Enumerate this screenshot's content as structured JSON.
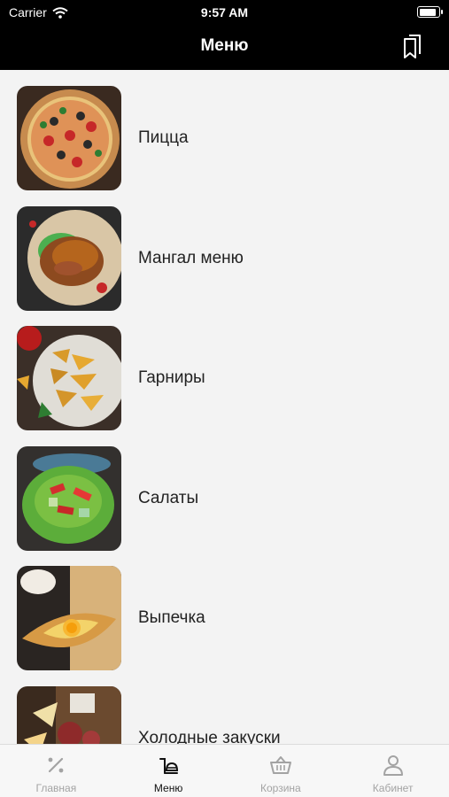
{
  "status_bar": {
    "carrier": "Carrier",
    "time": "9:57 AM",
    "battery_level": 0.9
  },
  "nav": {
    "title": "Меню",
    "right_icon": "bookmarks-icon"
  },
  "menu": {
    "items": [
      {
        "label": "Пицца",
        "image": "pizza-photo"
      },
      {
        "label": "Мангал меню",
        "image": "grilled-meat-photo"
      },
      {
        "label": "Гарниры",
        "image": "potato-wedges-photo"
      },
      {
        "label": "Салаты",
        "image": "salad-photo"
      },
      {
        "label": "Выпечка",
        "image": "khachapuri-photo"
      },
      {
        "label": "Холодные закуски",
        "image": "cold-appetizers-photo"
      }
    ]
  },
  "tabbar": {
    "tabs": [
      {
        "label": "Главная",
        "icon": "percent-icon",
        "active": false
      },
      {
        "label": "Меню",
        "icon": "menu-tray-icon",
        "active": true
      },
      {
        "label": "Корзина",
        "icon": "basket-icon",
        "active": false
      },
      {
        "label": "Кабинет",
        "icon": "user-icon",
        "active": false
      }
    ]
  },
  "colors": {
    "bar_bg": "#000000",
    "list_bg": "#f3f3f3",
    "tab_inactive": "#a3a3a3",
    "tab_active": "#111111"
  }
}
